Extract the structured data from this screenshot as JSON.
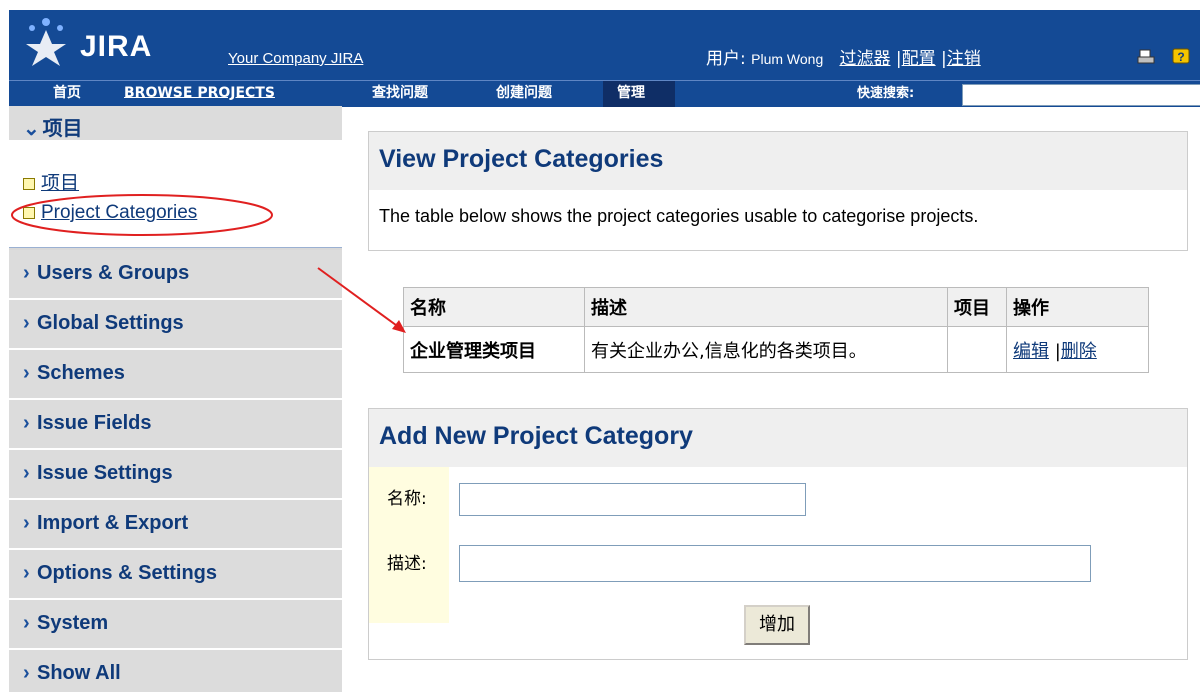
{
  "header": {
    "logo_text": "JIRA",
    "company_link": "Your Company JIRA",
    "user_label": "用户:",
    "user_name": "Plum Wong",
    "links": [
      "过滤器",
      "配置",
      "注销"
    ],
    "separator": "|"
  },
  "nav": {
    "items": [
      "首页",
      "BROWSE PROJECTS",
      "查找问题",
      "创建问题",
      "管理"
    ],
    "active_index": 4,
    "quick_search_label": "快速搜索:",
    "quick_search_value": ""
  },
  "sidebar": {
    "open_section": "项目",
    "open_links": [
      "项目",
      "Project Categories"
    ],
    "sections": [
      "Users & Groups",
      "Global Settings",
      "Schemes",
      "Issue Fields",
      "Issue Settings",
      "Import & Export",
      "Options & Settings",
      "System",
      "Show All"
    ]
  },
  "view_panel": {
    "title": "View Project Categories",
    "description": "The table below shows the project categories usable to categorise projects."
  },
  "table": {
    "headers": [
      "名称",
      "描述",
      "项目",
      "操作"
    ],
    "rows": [
      {
        "name": "企业管理类项目",
        "description": "有关企业办公,信息化的各类项目。",
        "projects": "",
        "edit": "编辑",
        "delete": "删除"
      }
    ],
    "separator": "|"
  },
  "add_panel": {
    "title": "Add New Project Category",
    "name_label": "名称:",
    "desc_label": "描述:",
    "name_value": "",
    "desc_value": "",
    "submit_label": "增加"
  },
  "colors": {
    "header_bg": "#144a95",
    "sidebar_bg": "#dcdcdc",
    "link": "#0f3a7a",
    "annotation": "#e02020"
  },
  "icons": [
    "jira-star-logo-icon",
    "print-icon",
    "help-icon",
    "chevron-down-icon",
    "chevron-right-icon",
    "bullet-square-icon"
  ]
}
